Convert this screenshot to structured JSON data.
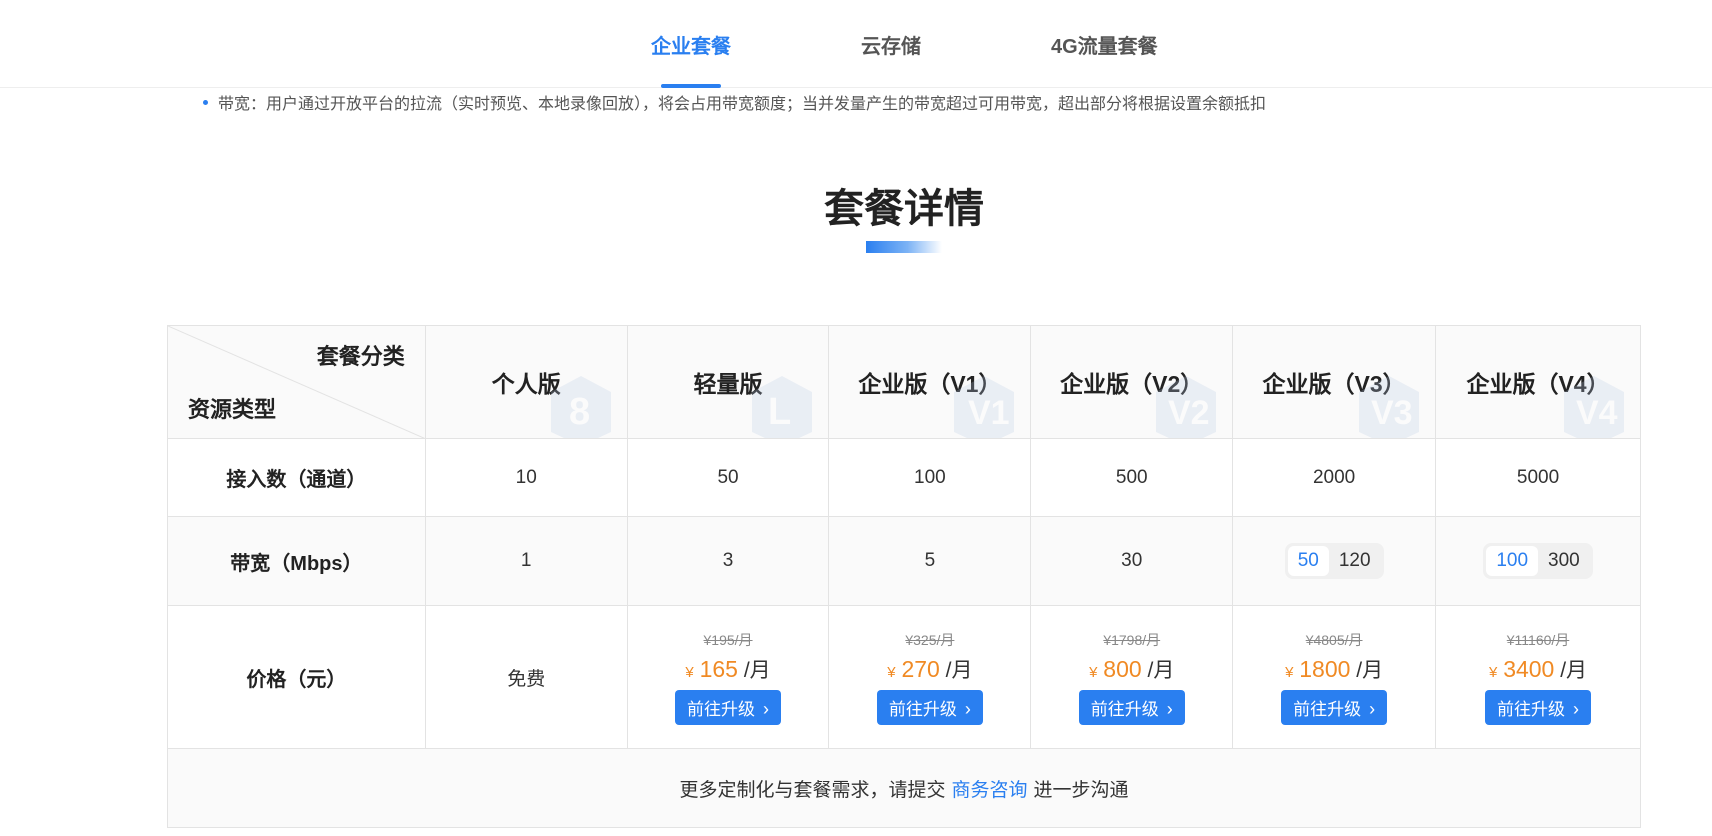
{
  "tabs": [
    {
      "label": "企业套餐",
      "active": true
    },
    {
      "label": "云存储",
      "active": false
    },
    {
      "label": "4G流量套餐",
      "active": false
    }
  ],
  "note": "带宽：用户通过开放平台的拉流（实时预览、本地录像回放），将会占用带宽额度；当并发量产生的带宽超过可用带宽，超出部分将根据设置余额抵扣",
  "section_title": "套餐详情",
  "table": {
    "corner_top": "套餐分类",
    "corner_bottom": "资源类型",
    "plans": [
      "个人版",
      "轻量版",
      "企业版（V1）",
      "企业版（V2）",
      "企业版（V3）",
      "企业版（V4）"
    ],
    "channels_label": "接入数（通道）",
    "channels": [
      "10",
      "50",
      "100",
      "500",
      "2000",
      "5000"
    ],
    "bandwidth_label": "带宽（Mbps）",
    "bandwidth": [
      "1",
      "3",
      "5",
      "30"
    ],
    "bandwidth_v3": {
      "selected": "50",
      "other": "120"
    },
    "bandwidth_v4": {
      "selected": "100",
      "other": "300"
    },
    "price_label": "价格（元）",
    "free_label": "免费",
    "currency": "¥",
    "per_month": "/月",
    "upgrade_label": "前往升级",
    "prices": [
      {
        "old": "¥195/月",
        "now": "165"
      },
      {
        "old": "¥325/月",
        "now": "270"
      },
      {
        "old": "¥1798/月",
        "now": "800"
      },
      {
        "old": "¥4805/月",
        "now": "1800"
      },
      {
        "old": "¥11160/月",
        "now": "3400"
      }
    ],
    "more_before": "更多定制化与套餐需求，请提交",
    "more_link": "商务咨询",
    "more_after": "进一步沟通"
  },
  "colors": {
    "accent": "#2a7ff0",
    "price": "#f08a24"
  }
}
